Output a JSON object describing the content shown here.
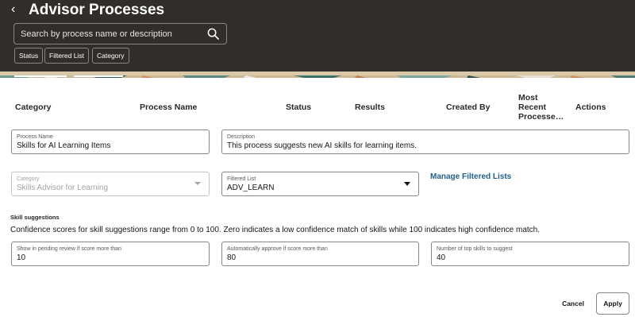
{
  "header": {
    "back_glyph": "‹",
    "title": "Advisor Processes",
    "search_placeholder": "Search by process name or description",
    "chips": [
      "Status",
      "Filtered List",
      "Category"
    ]
  },
  "table": {
    "columns": [
      "Category",
      "Process Name",
      "Status",
      "Results",
      "Created By",
      "Most Recent Processe…",
      "Actions"
    ]
  },
  "form": {
    "process_name": {
      "label": "Process Name",
      "value": "Skills for AI Learning Items"
    },
    "description": {
      "label": "Description",
      "value": "This process suggests new AI skills for learning items."
    },
    "category": {
      "label": "Category",
      "value": "Skills Advisor for Learning"
    },
    "filtered_list": {
      "label": "Filtered List",
      "value": "ADV_LEARN"
    },
    "manage_link": "Manage Filtered Lists",
    "skill_section_title": "Skill suggestions",
    "skill_help_text": "Confidence scores for skill suggestions range from 0 to 100. Zero indicates a low confidence match of skills while 100 indicates high confidence match.",
    "pending_review": {
      "label": "Show in pending review if score more than",
      "value": "10"
    },
    "auto_approve": {
      "label": "Automatically approve if score more than",
      "value": "80"
    },
    "top_skills": {
      "label": "Number of top skills to suggest",
      "value": "40"
    }
  },
  "footer": {
    "cancel_label": "Cancel",
    "apply_label": "Apply"
  },
  "colors": {
    "header_bg": "#312d2a",
    "link": "#1f5f8b"
  },
  "icons": [
    "back-icon",
    "search-icon",
    "chevron-down-icon"
  ]
}
